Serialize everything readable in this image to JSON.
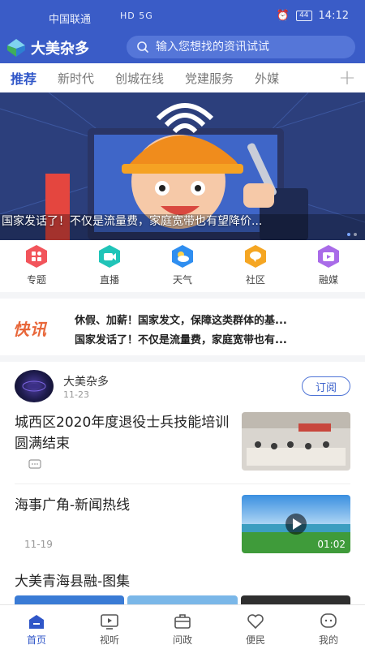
{
  "status": {
    "carrier": "中国联通",
    "signal": "HD 5G",
    "battery": "44",
    "time": "14:12"
  },
  "header": {
    "app_name": "大美杂多",
    "search_placeholder": "输入您想找的资讯试试"
  },
  "tabs": [
    "推荐",
    "新时代",
    "创城在线",
    "党建服务",
    "外媒"
  ],
  "banner": {
    "caption": "国家发话了！不仅是流量费，家庭宽带也有望降价..."
  },
  "quick": [
    "专题",
    "直播",
    "天气",
    "社区",
    "融媒"
  ],
  "flash": {
    "label": "快讯",
    "lines": [
      "休假、加薪！国家发文，保障这类群体的基...",
      "国家发话了！不仅是流量费，家庭宽带也有..."
    ]
  },
  "account": {
    "name": "大美杂多",
    "date": "11-23",
    "subscribe": "订阅"
  },
  "news": [
    {
      "title": "城西区2020年度退役士兵技能培训圆满结束",
      "meta": ""
    },
    {
      "title": "海事广角-新闻热线",
      "meta": "11-19",
      "duration": "01:02"
    }
  ],
  "gallery_title": "大美青海县融-图集",
  "bottom_nav": [
    "首页",
    "视听",
    "问政",
    "便民",
    "我的"
  ],
  "colors": {
    "brand": "#3a5cc7",
    "accent": "#2f56c8",
    "flash": "#e8673a"
  }
}
